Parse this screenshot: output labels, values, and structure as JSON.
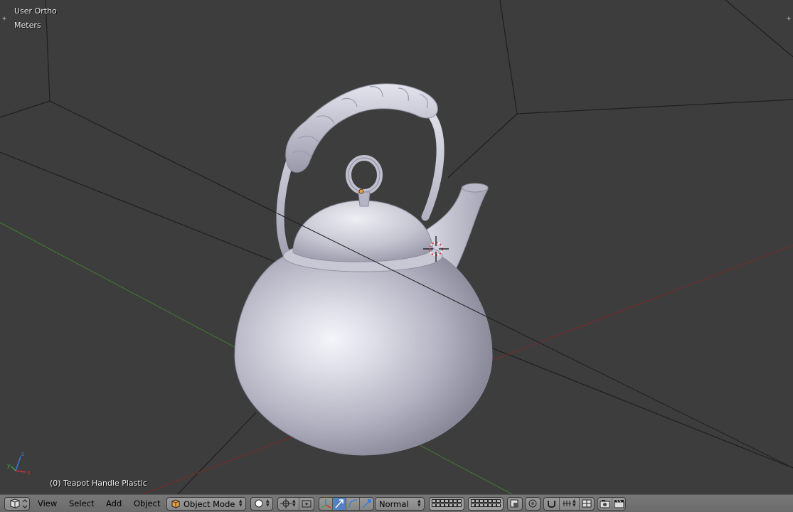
{
  "viewport": {
    "view_name": "User Ortho",
    "units": "Meters",
    "object_info": "(0) Teapot Handle Plastic"
  },
  "header": {
    "menus": [
      "View",
      "Select",
      "Add",
      "Object"
    ],
    "mode": "Object Mode",
    "orientation": "Normal"
  },
  "colors": {
    "background": "#3d3d3d",
    "grid": "#1e1e1e",
    "x_axis": "#8a2b2b",
    "y_axis": "#3f8a2b",
    "teapot": "#c8c8d6",
    "header": "#727272",
    "active_button": "#5680c2"
  }
}
